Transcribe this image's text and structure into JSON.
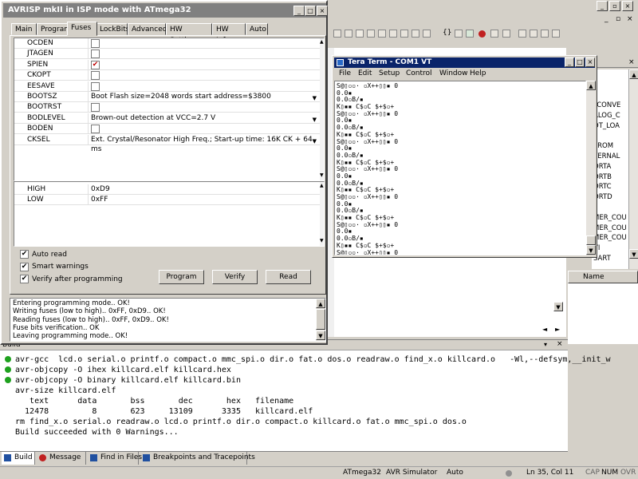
{
  "ide": {
    "title_buttons": [
      "_",
      "▫",
      "×"
    ],
    "toolbar_icons": [
      "dot-icon",
      "nav-back-icon",
      "nav-fwd-icon",
      "brace-icon",
      "run-icon",
      "stop-icon",
      "breakpoint-icon",
      "step-icon"
    ],
    "io_view": {
      "items": [
        "_CONVE",
        "ALOG_C",
        "OT_LOA",
        "J",
        "PROM",
        "TERNAL",
        "ORTA",
        "ORTB",
        "ORTC",
        "ORTD",
        "I",
        "MER_COU",
        "MER_COU",
        "MER_COU",
        "VI",
        "SART"
      ],
      "column_header": "Name"
    },
    "build": {
      "title": "Build",
      "lines": [
        {
          "text": "avr-gcc  lcd.o serial.o printf.o compact.o mmc_spi.o dir.o fat.o dos.o readraw.o find_x.o killcard.o   -Wl,--defsym,__init_w",
          "dot": true
        },
        {
          "text": "avr-objcopy -O ihex killcard.elf killcard.hex",
          "dot": true
        },
        {
          "text": "avr-objcopy -O binary killcard.elf killcard.bin",
          "dot": true
        },
        {
          "text": "avr-size killcard.elf",
          "dot": false
        },
        {
          "text": "   text      data       bss       dec       hex   filename",
          "dot": false
        },
        {
          "text": "  12478         8       623     13109      3335   killcard.elf",
          "dot": false
        },
        {
          "text": "rm find_x.o serial.o readraw.o lcd.o printf.o dir.o compact.o killcard.o fat.o mmc_spi.o dos.o",
          "dot": false
        },
        {
          "text": "Build succeeded with 0 Warnings...",
          "dot": false
        }
      ]
    },
    "bottom_tabs": [
      {
        "label": "Build",
        "icon": "build-icon"
      },
      {
        "label": "Message",
        "icon": "message-icon"
      },
      {
        "label": "Find in Files",
        "icon": "find-icon"
      },
      {
        "label": "Breakpoints and Tracepoints",
        "icon": "breakpoints-icon"
      }
    ],
    "status": {
      "device": "ATmega32",
      "platform": "AVR Simulator",
      "mode": "Auto",
      "position": "Ln 35, Col 11",
      "caps": "CAP",
      "num": "NUM",
      "ovr": "OVR"
    }
  },
  "avrisp": {
    "title": "AVRISP mkII in ISP mode with ATmega32",
    "title_buttons": [
      "_",
      "□",
      "×"
    ],
    "tabs": [
      "Main",
      "Program",
      "Fuses",
      "LockBits",
      "Advanced",
      "HW Settings",
      "HW Info",
      "Auto"
    ],
    "active_tab": "Fuses",
    "fuses": [
      {
        "name": "OCDEN",
        "type": "check",
        "checked": false
      },
      {
        "name": "JTAGEN",
        "type": "check",
        "checked": false
      },
      {
        "name": "SPIEN",
        "type": "check",
        "checked": true
      },
      {
        "name": "CKOPT",
        "type": "check",
        "checked": false
      },
      {
        "name": "EESAVE",
        "type": "check",
        "checked": false
      },
      {
        "name": "BOOTSZ",
        "type": "select",
        "value": "Boot Flash size=2048 words start address=$3800"
      },
      {
        "name": "BOOTRST",
        "type": "check",
        "checked": false
      },
      {
        "name": "BODLEVEL",
        "type": "select",
        "value": "Brown-out detection at VCC=2.7 V"
      },
      {
        "name": "BODEN",
        "type": "check",
        "checked": false
      },
      {
        "name": "CKSEL",
        "type": "select",
        "value": "Ext. Crystal/Resonator High Freq.; Start-up time: 16K CK + 64 ms"
      }
    ],
    "bytes": [
      {
        "name": "HIGH",
        "value": "0xD9"
      },
      {
        "name": "LOW",
        "value": "0xFF"
      }
    ],
    "options": [
      {
        "label": "Auto read",
        "checked": true
      },
      {
        "label": "Smart warnings",
        "checked": true
      },
      {
        "label": "Verify after programming",
        "checked": true
      }
    ],
    "buttons": {
      "program": "Program",
      "verify": "Verify",
      "read": "Read"
    },
    "log": [
      "Entering programming mode.. OK!",
      "Writing fuses (low to high).. 0xFF, 0xD9.. OK!",
      "Reading fuses (low to high).. 0xFF, 0xD9.. OK!",
      "Fuse bits verification.. OK",
      "Leaving programming mode.. OK!"
    ]
  },
  "teraterm": {
    "title": "Tera Term - COM1 VT",
    "title_buttons": [
      "_",
      "□",
      "×"
    ],
    "menu": [
      "File",
      "Edit",
      "Setup",
      "Control",
      "Window",
      "Help"
    ],
    "lines": [
      "S@▯▫▫· ▫X++▯▯▪ 0",
      "0.0▪",
      "0.0▫B/▪",
      "K▯▪▪ C$▫C $+$▫+",
      "S@▯▫▫· ▫X++▯▯▪ 0",
      "0.0▪",
      "0.0▫B/▪",
      "K▯▪▪ C$▫C $+$▫+",
      "S@▯▫▫· ▫X++▯▯▪ 0",
      "0.0▪",
      "0.0▫B/▪",
      "K▯▪▪ C$▫C $+$▫+",
      "S@▯▫▫· ▫X++▯▯▪ 0",
      "0.0▪",
      "0.0▫B/▪",
      "K▯▪▪ C$▫C $+$▫+",
      "S@▯▫▫· ▫X++▯▯▪ 0",
      "0.0▪",
      "0.0▫B/▪",
      "K▯▪▪ C$▫C $+$▫+",
      "S@▯▫▫· ▫X++▯▯▪ 0",
      "0.0▪",
      "0.0▫B/▪",
      "K▯▪▪ C$▫C $+$▫+",
      "S@▯▫▫· ▫X++▯▯▪ 0",
      "0.0▪",
      "0.0▫B/▪"
    ]
  }
}
